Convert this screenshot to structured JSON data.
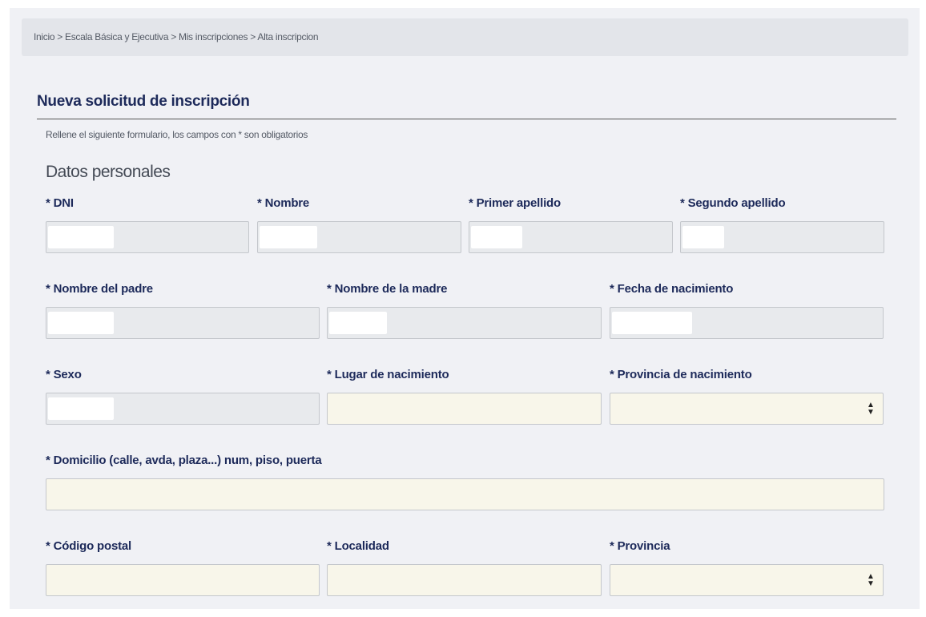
{
  "breadcrumb": "Inicio > Escala Básica y Ejecutiva > Mis inscripciones > Alta inscripcion",
  "title": "Nueva solicitud de inscripción",
  "instructions": "Rellene el siguiente formulario, los campos con * son obligatorios",
  "section_title": "Datos personales",
  "fields": {
    "dni": {
      "label": "* DNI",
      "value": ""
    },
    "nombre": {
      "label": "* Nombre",
      "value": ""
    },
    "primer_apellido": {
      "label": "* Primer apellido",
      "value": ""
    },
    "segundo_apellido": {
      "label": "* Segundo apellido",
      "value": ""
    },
    "nombre_padre": {
      "label": "* Nombre del padre",
      "value": ""
    },
    "nombre_madre": {
      "label": "* Nombre de la madre",
      "value": ""
    },
    "fecha_nacimiento": {
      "label": "* Fecha de nacimiento",
      "value": ""
    },
    "sexo": {
      "label": "* Sexo",
      "value": ""
    },
    "lugar_nacimiento": {
      "label": "* Lugar de nacimiento",
      "value": ""
    },
    "provincia_nacimiento": {
      "label": "* Provincia de nacimiento",
      "value": ""
    },
    "domicilio": {
      "label": "* Domicilio (calle, avda, plaza...) num, piso, puerta",
      "value": ""
    },
    "codigo_postal": {
      "label": "* Código postal",
      "value": ""
    },
    "localidad": {
      "label": "* Localidad",
      "value": ""
    },
    "provincia": {
      "label": "* Provincia",
      "value": ""
    }
  },
  "icons": {
    "select_arrow": "sort-arrows-icon"
  },
  "colors": {
    "label": "#1d2a5a",
    "readonly_bg": "#e8eaed",
    "editable_bg": "#f8f6ea"
  }
}
